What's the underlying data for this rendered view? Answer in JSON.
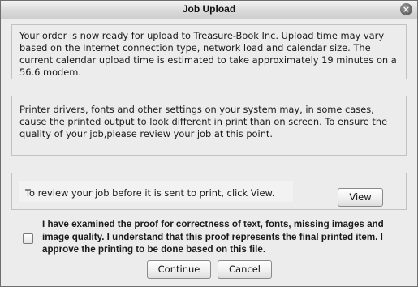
{
  "window": {
    "title": "Job Upload",
    "close_glyph": "×"
  },
  "upload_info": {
    "text": "Your order is now ready for upload to Treasure-Book Inc. Upload time may vary based on the Internet connection type, network load and calendar size. The current calendar upload time is estimated to take approximately 19 minutes on a 56.6 modem."
  },
  "printer_notice": {
    "text": "Printer drivers, fonts and other settings on your system may, in some cases, cause the printed output to look different in print than on screen.  To ensure the quality of your job,please review your job at this point."
  },
  "review": {
    "instruction": "To review your job before it is sent to print, click View.",
    "view_label": "View"
  },
  "confirmation": {
    "checked": false,
    "text": "I have examined the proof for correctness of text, fonts, missing images and image quality. I understand that this proof represents the final printed item. I approve the printing to be done based on this file."
  },
  "actions": {
    "continue_label": "Continue",
    "cancel_label": "Cancel"
  }
}
